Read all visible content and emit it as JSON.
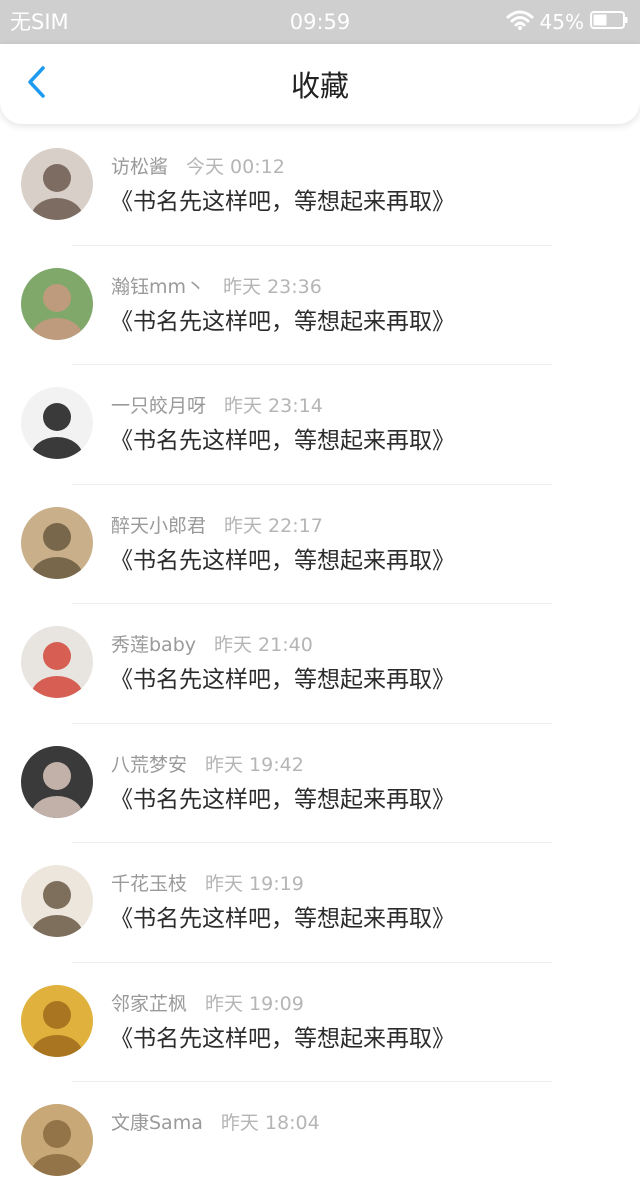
{
  "status_bar": {
    "carrier": "无SIM",
    "time": "09:59",
    "battery": "45%"
  },
  "nav": {
    "title": "收藏",
    "back_icon": "chevron-left-icon",
    "accent": "#1e9bf0"
  },
  "items": [
    {
      "name": "访松酱",
      "time": "今天 00:12",
      "title": "《书名先这样吧，等想起来再取》",
      "avatar": [
        "#d8cfc8",
        "#6d5a50"
      ]
    },
    {
      "name": "瀚钰mm丶",
      "time": "昨天 23:36",
      "title": "《书名先这样吧，等想起来再取》",
      "avatar": [
        "#7fa86a",
        "#c9997f"
      ]
    },
    {
      "name": "一只皎月呀",
      "time": "昨天 23:14",
      "title": "《书名先这样吧，等想起来再取》",
      "avatar": [
        "#f2f2f2",
        "#1a1a1a"
      ]
    },
    {
      "name": "醉天小郎君",
      "time": "昨天 22:17",
      "title": "《书名先这样吧，等想起来再取》",
      "avatar": [
        "#c9b08a",
        "#6b5a40"
      ]
    },
    {
      "name": "秀莲baby",
      "time": "昨天 21:40",
      "title": "《书名先这样吧，等想起来再取》",
      "avatar": [
        "#e8e4e0",
        "#d2463a"
      ]
    },
    {
      "name": "八荒梦安",
      "time": "昨天 19:42",
      "title": "《书名先这样吧，等想起来再取》",
      "avatar": [
        "#3a3a3a",
        "#d9c7bd"
      ]
    },
    {
      "name": "千花玉枝",
      "time": "昨天 19:19",
      "title": "《书名先这样吧，等想起来再取》",
      "avatar": [
        "#ece6dc",
        "#6b5845"
      ]
    },
    {
      "name": "邻家芷枫",
      "time": "昨天 19:09",
      "title": "《书名先这样吧，等想起来再取》",
      "avatar": [
        "#e0b13c",
        "#a06b1c"
      ]
    },
    {
      "name": "文康Sama",
      "time": "昨天 18:04",
      "title": "",
      "avatar": [
        "#c9a877",
        "#8a6b40"
      ]
    }
  ]
}
